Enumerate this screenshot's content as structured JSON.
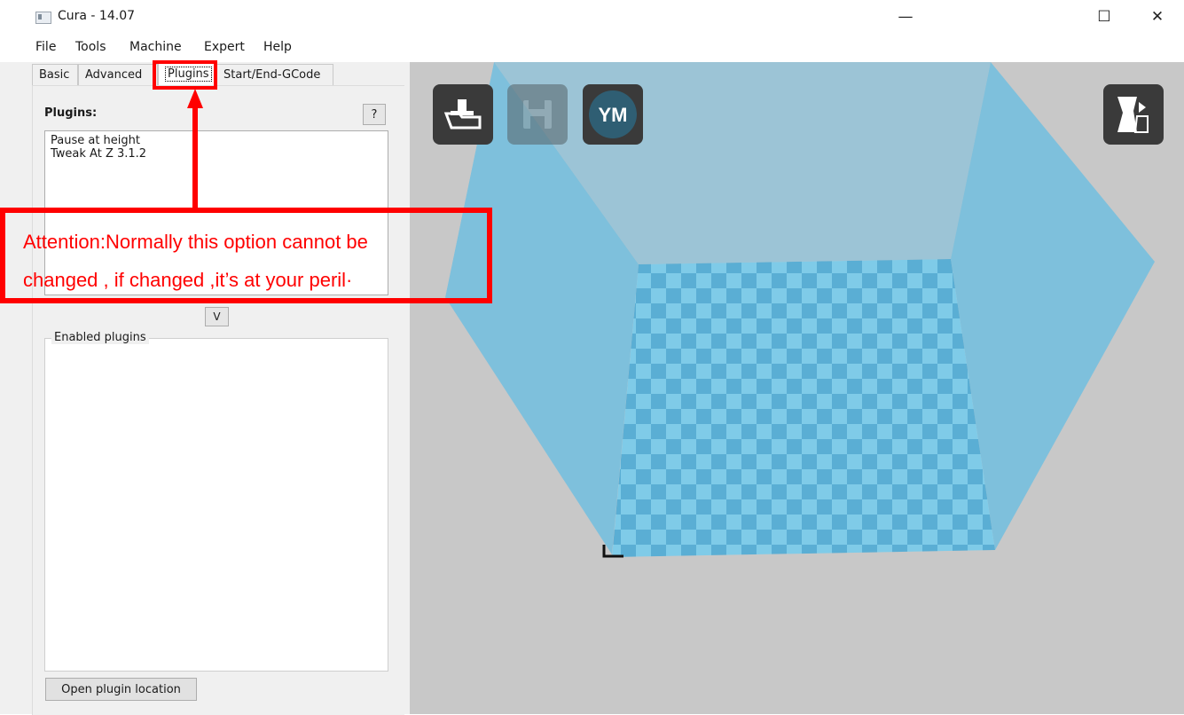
{
  "window": {
    "title": "Cura - 14.07",
    "minimize_glyph": "—",
    "maximize_glyph": "☐",
    "close_glyph": "✕"
  },
  "menu": [
    "File",
    "Tools",
    "Machine",
    "Expert",
    "Help"
  ],
  "tabs": [
    "Basic",
    "Advanced",
    "Plugins",
    "Start/End-GCode"
  ],
  "active_tab": "Plugins",
  "plugins_panel": {
    "label": "Plugins:",
    "help_button": "?",
    "available": [
      "Pause at height",
      "Tweak At Z 3.1.2"
    ],
    "move_button": "V",
    "enabled_group_label": "Enabled plugins",
    "enabled": [],
    "open_location_button": "Open plugin location"
  },
  "viewport": {
    "toolbar": [
      {
        "name": "load-model",
        "icon": "load-icon"
      },
      {
        "name": "save-gcode",
        "icon": "save-icon",
        "state": "disabled"
      },
      {
        "name": "youmagine",
        "icon": "youmagine-icon",
        "label": "YM"
      },
      {
        "name": "view-mode",
        "icon": "view-mode-icon"
      }
    ],
    "colors": {
      "background": "#c8c8c8",
      "build_volume": "#7ec0dc",
      "plate_light": "#7fcbe8",
      "plate_dark": "#5aaed4"
    }
  },
  "annotation": {
    "line1": "Attention:Normally this option cannot be",
    "line2": "changed , if changed ,it’s at your peril·",
    "color": "#ff0000"
  }
}
